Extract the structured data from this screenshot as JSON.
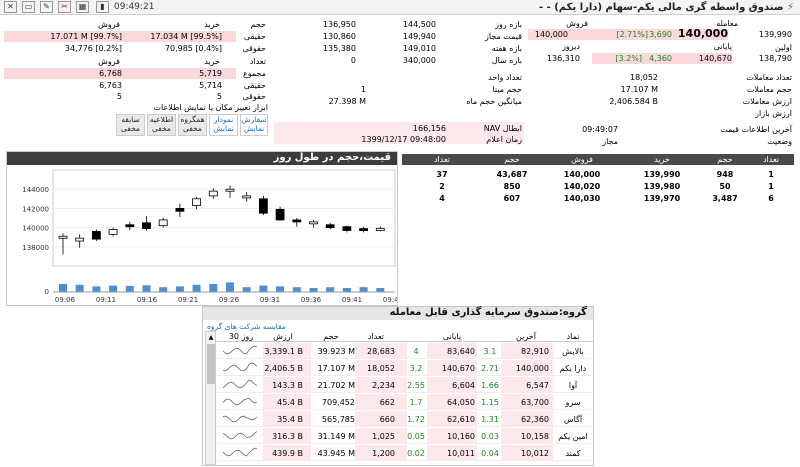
{
  "toolbar": {
    "time": "09:49:21"
  },
  "title": "صندوق واسطه گری مالی یکم-سهام (دارا یکم) - -",
  "left_stats": {
    "hdr": [
      "فروش",
      "خرید"
    ],
    "rows": [
      [
        "17.071 M [99.7%]",
        "17.034 M [99.5%]"
      ],
      [
        "34,776 [0.2%]",
        "70,985 [0.4%]"
      ]
    ],
    "sub_hdr": [
      "فروش",
      "خرید"
    ],
    "vals": [
      [
        "6,768",
        "5,719"
      ],
      [
        "6,763",
        "5,714"
      ],
      [
        "5",
        "5"
      ]
    ]
  },
  "legal_labels": {
    "hdr": "حجم",
    "real": "حقیقی",
    "legal": "حقوقی",
    "count": "تعداد",
    "total": "مجموع",
    "real2": "حقیقی",
    "legal2": "حقوقی"
  },
  "mid_stats": {
    "c1": [
      "136,950",
      "144,500"
    ],
    "c2": [
      "130,860",
      "149,940"
    ],
    "c3": [
      "135,380",
      "149,010"
    ],
    "c4": [
      "0",
      "340,000"
    ],
    "lbl": [
      "بازه روز",
      "قیمت مجاز",
      "بازه هفته",
      "بازه سال"
    ]
  },
  "mid_info": {
    "unit_lbl": "تعداد واحد",
    "base_lbl": "حجم مبنا",
    "avgvol_lbl": "میانگین حجم ماه",
    "base_val": "1",
    "avgvol_val": "27.398 M",
    "nav_lbl": "NAV ابطال",
    "nav_val": "166,156",
    "navtime_lbl": "زمان اعلام",
    "navtime_val": "1399/12/17 09:48:00"
  },
  "right_info": {
    "trade_lbl": "معامله",
    "sell_lbl": "فروش",
    "last_lbl": "پایانی",
    "close_lbl": "دیروز",
    "first_lbl": "اولین",
    "trade_val": "140,000",
    "trade_chg": "3,690",
    "trade_pct": "[2.71%]",
    "sell_val": "140,000",
    "close_val": "136,310",
    "last_val": "140,670",
    "last_chg": "4,360",
    "last_pct": "[3.2%]",
    "first_val": "139,990",
    "prev_val": "138,790",
    "count_lbl": "تعداد معاملات",
    "count_val": "18,052",
    "vol_lbl": "حجم معاملات",
    "vol_val": "17.107 M",
    "value_lbl": "ارزش معاملات",
    "value_val": "2,406.584 B",
    "mkt_lbl": "ارزش بازار",
    "last_info_lbl": "آخرین اطلاعات قیمت",
    "last_info_val": "09:49:07",
    "status_lbl": "وضعیت",
    "status_val": "مجاز"
  },
  "view_buttons": {
    "title": "ابزار تغییر مکان یا نمایش اطلاعات",
    "items": [
      "سفارش\nنمایش",
      "نمودار\nنمایش",
      "همگروه\nمخفی",
      "اطلاعیه\nمخفی",
      "سابقه\nمخفی"
    ]
  },
  "chart": {
    "title": "قیمت،حجم در طول روز",
    "time_labels": [
      "09:06",
      "09:11",
      "09:16",
      "09:21",
      "09:26",
      "09:31",
      "09:36",
      "09:41",
      "09:46"
    ]
  },
  "chart_data": {
    "type": "candlestick",
    "ylim": [
      136000,
      146000
    ],
    "yticks": [
      "144000",
      "142000",
      "140000",
      "138000"
    ],
    "vol_tick": "0",
    "candles": [
      [
        139000,
        139100,
        137800,
        139400,
        137200,
        0.5
      ],
      [
        138600,
        138900,
        138000,
        139300,
        137900,
        0.45
      ],
      [
        139600,
        138800,
        138700,
        139800,
        138600,
        0.35
      ],
      [
        139300,
        139800,
        139200,
        140000,
        139100,
        0.4
      ],
      [
        140300,
        140200,
        140100,
        140600,
        139700,
        0.38
      ],
      [
        140500,
        139900,
        139800,
        141200,
        139700,
        0.42
      ],
      [
        140200,
        140800,
        140100,
        141000,
        140000,
        0.3
      ],
      [
        142000,
        141700,
        141400,
        142500,
        141100,
        0.35
      ],
      [
        142300,
        143000,
        142200,
        143200,
        141900,
        0.45
      ],
      [
        143300,
        143800,
        143200,
        144100,
        143000,
        0.5
      ],
      [
        144000,
        144000,
        143300,
        144400,
        143100,
        0.6
      ],
      [
        143300,
        143300,
        143200,
        143700,
        142700,
        0.3
      ],
      [
        143000,
        141500,
        141500,
        143300,
        141300,
        0.4
      ],
      [
        141900,
        140800,
        140800,
        142200,
        140700,
        0.35
      ],
      [
        140800,
        140700,
        140200,
        141000,
        140100,
        0.3
      ],
      [
        140400,
        140600,
        140100,
        140800,
        140000,
        0.25
      ],
      [
        140300,
        140000,
        139900,
        140500,
        139800,
        0.3
      ],
      [
        140100,
        139700,
        139700,
        140200,
        139500,
        0.25
      ],
      [
        139900,
        139800,
        139600,
        140100,
        139500,
        0.3
      ],
      [
        139900,
        139900,
        139700,
        140100,
        139600,
        0.25
      ]
    ]
  },
  "orderbook": {
    "headers": [
      "تعداد",
      "حجم",
      "خرید",
      "فروش",
      "حجم",
      "تعداد"
    ],
    "rows": [
      [
        "1",
        "948",
        "139,990",
        "140,000",
        "43,687",
        "37"
      ],
      [
        "1",
        "50",
        "139,980",
        "140,020",
        "850",
        "2"
      ],
      [
        "6",
        "3,487",
        "139,970",
        "140,030",
        "607",
        "4"
      ]
    ]
  },
  "group": {
    "title": "گروه:صندوق سرمایه گذاری قابل معامله",
    "compare_link": "مقایسه شرکت های گروه",
    "headers": [
      "نماد",
      "آخرین",
      "",
      "پایانی",
      "",
      "تعداد",
      "حجم",
      "ارزش",
      "30 روز"
    ],
    "rows": [
      [
        "بالایش",
        "82,910",
        "3.1",
        "83,640",
        "4",
        "28,683",
        "39.923 M",
        "3,339.1 B"
      ],
      [
        "دارا یکم",
        "140,000",
        "2.71",
        "140,670",
        "3.2",
        "18,052",
        "17.107 M",
        "2,406.5 B"
      ],
      [
        "آوا",
        "6,547",
        "1.66",
        "6,604",
        "2.55",
        "2,234",
        "21.702 M",
        "143.3 B"
      ],
      [
        "سرو",
        "63,700",
        "1.15",
        "64,050",
        "1.7",
        "662",
        "709,452",
        "45.4 B"
      ],
      [
        "آگاس",
        "62,360",
        "1.31",
        "62,610",
        "1.72",
        "660",
        "565,785",
        "35.4 B"
      ],
      [
        "امین یکم",
        "10,158",
        "0.03",
        "10,160",
        "0.05",
        "1,025",
        "31.149 M",
        "316.3 B"
      ],
      [
        "کمند",
        "10,012",
        "0.04",
        "10,011",
        "0.02",
        "1,200",
        "43.945 M",
        "439.9 B"
      ]
    ]
  }
}
